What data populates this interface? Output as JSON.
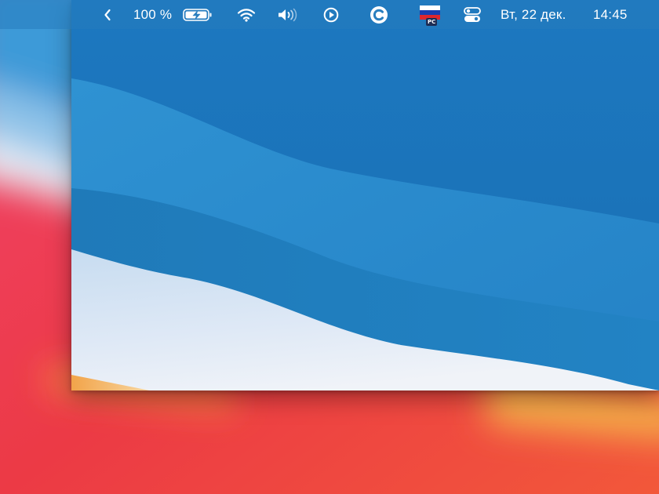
{
  "menubar": {
    "collapse_icon": "chevron-left-icon",
    "battery": {
      "percent_label": "100 %",
      "level": 1.0,
      "charging": true,
      "icon": "battery-charging-icon"
    },
    "wifi_icon": "wifi-icon",
    "volume_icon": "volume-icon",
    "media_icon": "play-circle-icon",
    "app_icon": "c-circle-icon",
    "input_source": {
      "icon": "russian-flag-icon",
      "label": "PC"
    },
    "control_center_icon": "control-center-icon",
    "date": "Вт, 22 дек.",
    "time": "14:45"
  },
  "colors": {
    "menubar_text": "#ffffff",
    "wallpaper_blue_top": "#1f7fc6",
    "wallpaper_blue_mid": "#2a8ccc",
    "wallpaper_light": "#d9e8f6",
    "blur_red": "#e8354a",
    "blur_orange": "#f3a64a"
  }
}
